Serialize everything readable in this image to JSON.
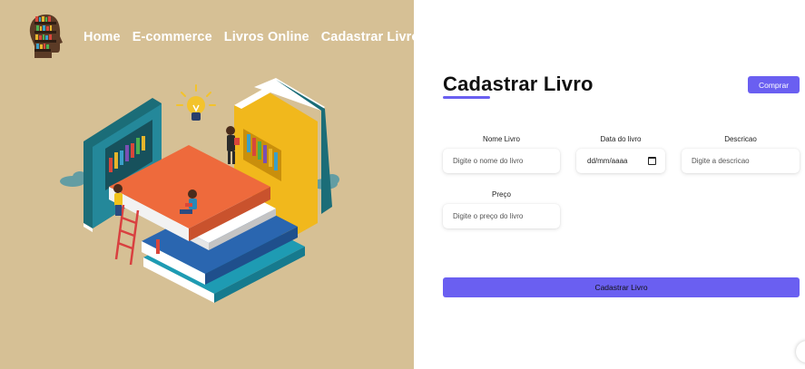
{
  "nav": {
    "items": [
      "Home",
      "E-commerce",
      "Livros Online",
      "Cadastrar Livro"
    ]
  },
  "page": {
    "title": "Cadastrar Livro",
    "buy_button": "Comprar"
  },
  "form": {
    "name": {
      "label": "Nome Livro",
      "placeholder": "Digite o nome do livro"
    },
    "date": {
      "label": "Data do livro",
      "value": "dd/mm/aaaa"
    },
    "description": {
      "label": "Descricao",
      "placeholder": "Digite a descricao"
    },
    "price": {
      "label": "Preço",
      "placeholder": "Digite o preço do livro"
    },
    "submit_label": "Cadastrar Livro"
  },
  "colors": {
    "left_background": "#d6c095",
    "accent": "#6a5ff1"
  },
  "icons": [
    "head-bookshelf-logo-icon",
    "calendar-icon",
    "books-illustration",
    "lightbulb-icon"
  ]
}
